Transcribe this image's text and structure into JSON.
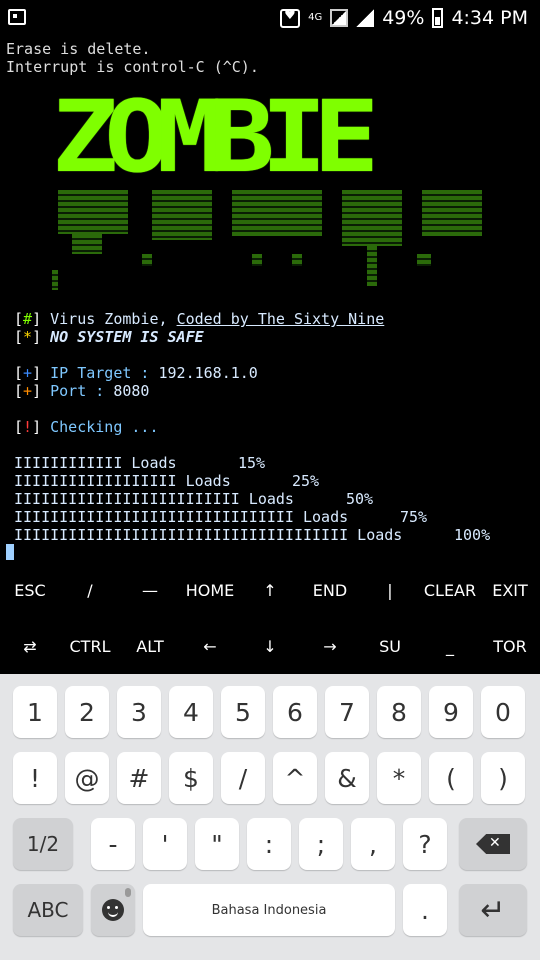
{
  "status_bar": {
    "network": "4G",
    "battery": "49%",
    "time": "4:34 PM",
    "icons": [
      "screenshot-icon",
      "notification-icon",
      "signal-icon",
      "battery-icon"
    ]
  },
  "terminal": {
    "line1": "Erase is delete.",
    "line2": "Interrupt is control-C (^C).",
    "logo_text": "ZOMBIE",
    "info": {
      "tag1": "#",
      "virus_text": " Virus Zombie, ",
      "coded_by": "Coded by The Sixty Nine",
      "tag2": "*",
      "no_system": " NO SYSTEM IS SAFE",
      "tag3": "+",
      "ip_label": " IP Target : ",
      "ip_value": "192.168.1.0",
      "tag4": "+",
      "port_label": " Port : ",
      "port_value": "8080",
      "tag5": "!",
      "checking": " Checking ..."
    },
    "loads": [
      {
        "bar": "IIIIIIIIIIII Loads",
        "percent": "15%"
      },
      {
        "bar": "IIIIIIIIIIIIIIIIII Loads",
        "percent": "25%"
      },
      {
        "bar": "IIIIIIIIIIIIIIIIIIIIIIIII Loads",
        "percent": "50%"
      },
      {
        "bar": "IIIIIIIIIIIIIIIIIIIIIIIIIIIIIII Loads",
        "percent": "75%"
      },
      {
        "bar": "IIIIIIIIIIIIIIIIIIIIIIIIIIIIIIIIIIIII Loads",
        "percent": "100%"
      }
    ]
  },
  "extra_keys": {
    "row1": [
      "ESC",
      "/",
      "—",
      "HOME",
      "↑",
      "END",
      "|",
      "CLEAR",
      "EXIT"
    ],
    "row2": [
      "⇄",
      "CTRL",
      "ALT",
      "←",
      "↓",
      "→",
      "SU",
      "_",
      "TOR"
    ]
  },
  "keyboard": {
    "row1": [
      "1",
      "2",
      "3",
      "4",
      "5",
      "6",
      "7",
      "8",
      "9",
      "0"
    ],
    "row2": [
      "!",
      "@",
      "#",
      "$",
      "/",
      "^",
      "&",
      "*",
      "(",
      ")"
    ],
    "row3_fn": "1/2",
    "row3": [
      "-",
      "'",
      "\"",
      ":",
      ";",
      ",",
      "?"
    ],
    "abc": "ABC",
    "space": "Bahasa Indonesia",
    "period": "."
  }
}
